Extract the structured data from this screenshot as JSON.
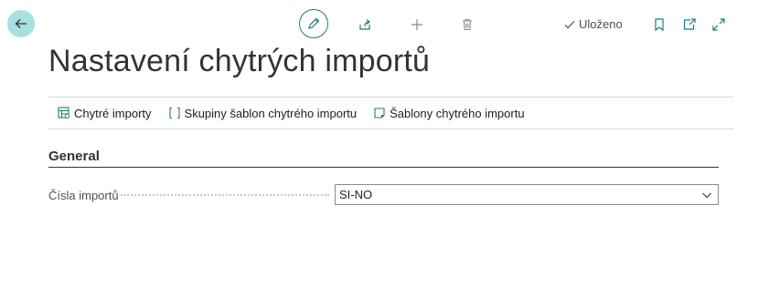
{
  "topbar": {
    "back_icon": "arrow-left-icon",
    "edit_icon": "pencil-icon",
    "share_icon": "share-icon",
    "add_icon": "plus-icon",
    "delete_icon": "trash-icon",
    "saved_label": "Uloženo",
    "bookmark_icon": "bookmark-icon",
    "popout_icon": "open-in-new-window-icon",
    "expand_icon": "expand-icon",
    "accent_color": "#1f7a80",
    "back_bg_color": "#a8dfdf"
  },
  "page": {
    "title": "Nastavení chytrých importů"
  },
  "actions": [
    {
      "label": "Chytré importy",
      "icon": "table-settings-icon"
    },
    {
      "label": "Skupiny šablon chytrého importu",
      "icon": "brackets-icon"
    },
    {
      "label": "Šablony chytrého importu",
      "icon": "template-icon"
    }
  ],
  "section": {
    "title": "General",
    "fields": [
      {
        "label": "Čísla importů",
        "value": "SI-NO"
      }
    ]
  }
}
